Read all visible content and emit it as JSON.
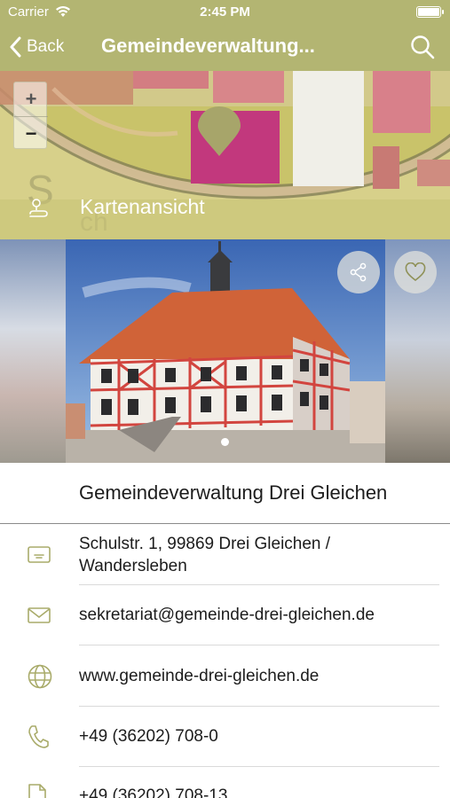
{
  "status_bar": {
    "carrier": "Carrier",
    "time": "2:45 PM"
  },
  "nav": {
    "back_label": "Back",
    "title": "Gemeindeverwaltung..."
  },
  "map": {
    "zoom_in": "+",
    "zoom_out": "−",
    "label": "Kartenansicht"
  },
  "detail": {
    "name": "Gemeindeverwaltung Drei Gleichen",
    "address_line1": "Schulstr. 1, 99869 Drei Gleichen /",
    "address_line2": "Wandersleben",
    "email": "sekretariat@gemeinde-drei-gleichen.de",
    "website": "www.gemeinde-drei-gleichen.de",
    "phone": "+49 (36202) 708-0",
    "fax": "+49 (36202) 708-13"
  },
  "colors": {
    "accent": "#b3b572",
    "icon": "#a9ab6a"
  }
}
